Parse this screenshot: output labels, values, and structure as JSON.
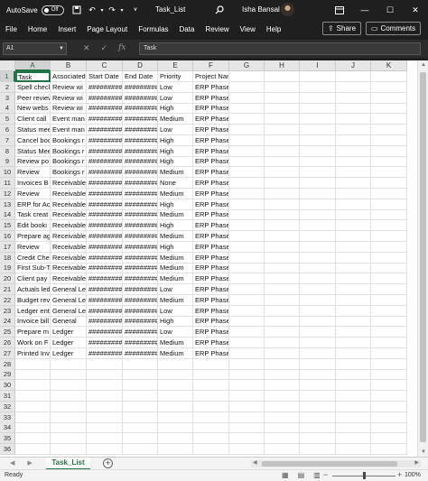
{
  "titlebar": {
    "autosave_label": "AutoSave",
    "autosave_state": "Off",
    "file_name": "Task_List",
    "user_name": "Isha Bansal"
  },
  "menu": [
    "File",
    "Home",
    "Insert",
    "Page Layout",
    "Formulas",
    "Data",
    "Review",
    "View",
    "Help"
  ],
  "share_label": "Share",
  "comments_label": "Comments",
  "formula_bar": {
    "name_box": "A1",
    "content": "Task"
  },
  "columns": [
    "A",
    "B",
    "C",
    "D",
    "E",
    "F",
    "G",
    "H",
    "I",
    "J",
    "K"
  ],
  "row_numbers": [
    "1",
    "2",
    "3",
    "4",
    "5",
    "6",
    "7",
    "8",
    "9",
    "10",
    "11",
    "12",
    "13",
    "14",
    "15",
    "16",
    "17",
    "18",
    "19",
    "20",
    "21",
    "22",
    "23",
    "24",
    "25",
    "26",
    "27",
    "28",
    "29",
    "30",
    "31",
    "32",
    "33",
    "34",
    "35",
    "36"
  ],
  "rows": [
    [
      "Task",
      "Associated",
      "Start Date",
      "End Date",
      "Priority",
      "Project Name"
    ],
    [
      "Spell check",
      "Review wi",
      "#########",
      "#########",
      "Low",
      "ERP Phase III"
    ],
    [
      "Peer review",
      "Review wi",
      "#########",
      "#########",
      "Low",
      "ERP Phase III"
    ],
    [
      "New webs",
      "Review wi",
      "#########",
      "#########",
      "High",
      "ERP Phase III"
    ],
    [
      "Client call",
      "Event man",
      "#########",
      "#########",
      "Medium",
      "ERP Phase III"
    ],
    [
      "Status mee",
      "Event man",
      "#########",
      "#########",
      "Low",
      "ERP Phase III"
    ],
    [
      "Cancel boo",
      "Bookings r",
      "#########",
      "#########",
      "High",
      "ERP Phase III"
    ],
    [
      "Status Mee",
      "Bookings r",
      "#########",
      "#########",
      "High",
      "ERP Phase III"
    ],
    [
      "Review po",
      "Bookings r",
      "#########",
      "#########",
      "High",
      "ERP Phase III"
    ],
    [
      "Review",
      "Bookings r",
      "#########",
      "#########",
      "Medium",
      "ERP Phase III"
    ],
    [
      "Invoices B",
      "Receivable",
      "#########",
      "#########",
      "None",
      "ERP Phase III"
    ],
    [
      "Review",
      "Receivable",
      "#########",
      "#########",
      "Medium",
      "ERP Phase III"
    ],
    [
      "ERP for Ac",
      "Receivable",
      "#########",
      "#########",
      "High",
      "ERP Phase III"
    ],
    [
      "Task creat",
      "Receivable",
      "#########",
      "#########",
      "Medium",
      "ERP Phase III"
    ],
    [
      "Edit booki",
      "Receivable",
      "#########",
      "#########",
      "High",
      "ERP Phase III"
    ],
    [
      "Prepare ag",
      "Receivable",
      "#########",
      "#########",
      "Medium",
      "ERP Phase III"
    ],
    [
      "Review",
      "Receivable",
      "#########",
      "#########",
      "High",
      "ERP Phase III"
    ],
    [
      "Credit Che",
      "Receivable",
      "#########",
      "#########",
      "Medium",
      "ERP Phase III"
    ],
    [
      "First Sub-T",
      "Receivable",
      "#########",
      "#########",
      "Medium",
      "ERP Phase III"
    ],
    [
      "Client pay",
      "Receivable",
      "#########",
      "#########",
      "Medium",
      "ERP Phase III"
    ],
    [
      "Actuals led",
      "General Le",
      "#########",
      "#########",
      "Low",
      "ERP Phase III"
    ],
    [
      "Budget rev",
      "General Le",
      "#########",
      "#########",
      "Medium",
      "ERP Phase III"
    ],
    [
      "Ledger ent",
      "General Le",
      "#########",
      "#########",
      "Low",
      "ERP Phase III"
    ],
    [
      "Invoice bill",
      "General",
      "#########",
      "#########",
      "High",
      "ERP Phase III"
    ],
    [
      "Prepare m",
      "Ledger",
      "#########",
      "#########",
      "Low",
      "ERP Phase III"
    ],
    [
      "Work on F",
      "Ledger",
      "#########",
      "#########",
      "Medium",
      "ERP Phase III"
    ],
    [
      "Printed Inv",
      "Ledger",
      "#########",
      "#########",
      "Medium",
      "ERP Phase III"
    ]
  ],
  "sheet_tab": "Task_List",
  "status": "Ready",
  "zoom": "100%"
}
